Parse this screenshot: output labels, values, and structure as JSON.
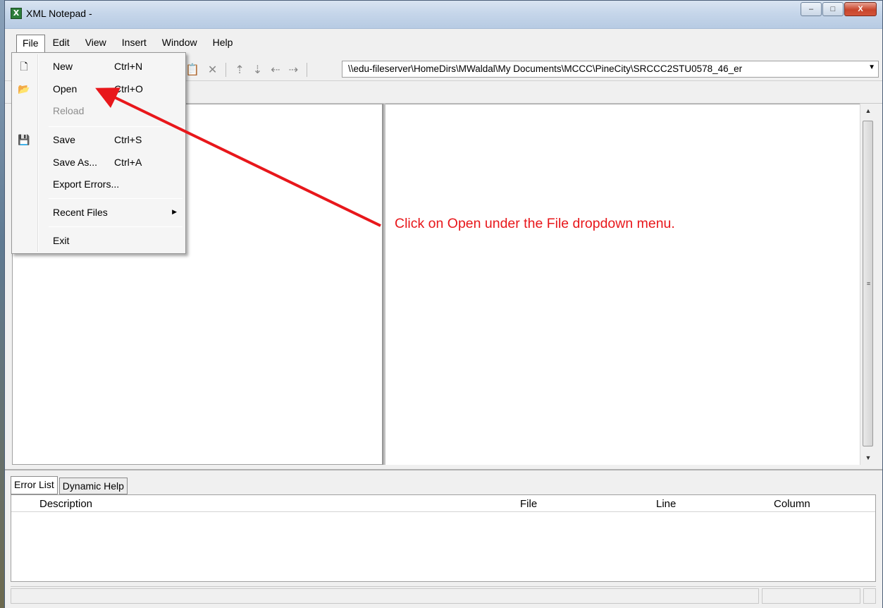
{
  "window": {
    "title": "XML Notepad -",
    "app_icon_letter": "X",
    "controls": {
      "minimize": "–",
      "maximize": "□",
      "close": "X"
    }
  },
  "menubar": {
    "items": [
      "File",
      "Edit",
      "View",
      "Insert",
      "Window",
      "Help"
    ],
    "active": "File"
  },
  "toolbar": {
    "path": "\\\\edu-fileserver\\HomeDirs\\MWaldal\\My Documents\\MCCC\\PineCity\\SRCCC2STU0578_46_er"
  },
  "file_menu": {
    "items": [
      {
        "label": "New",
        "shortcut": "Ctrl+N",
        "icon": "new-document-icon",
        "enabled": true
      },
      {
        "label": "Open",
        "shortcut": "Ctrl+O",
        "icon": "open-folder-icon",
        "enabled": true
      },
      {
        "label": "Reload",
        "shortcut": "",
        "icon": "",
        "enabled": false
      },
      {
        "label": "Save",
        "shortcut": "Ctrl+S",
        "icon": "floppy-disk-icon",
        "enabled": true
      },
      {
        "label": "Save As...",
        "shortcut": "Ctrl+A",
        "icon": "",
        "enabled": true
      },
      {
        "label": "Export Errors...",
        "shortcut": "",
        "icon": "",
        "enabled": true
      },
      {
        "label": "Recent Files",
        "shortcut": "",
        "icon": "",
        "enabled": true,
        "has_submenu": true
      },
      {
        "label": "Exit",
        "shortcut": "",
        "icon": "",
        "enabled": true
      }
    ]
  },
  "annotation": {
    "text": "Click on Open under the File dropdown menu.",
    "color": "#e8171b"
  },
  "bottom_panel": {
    "tabs": [
      "Error List",
      "Dynamic Help"
    ],
    "active_tab": "Error List",
    "columns": [
      "Description",
      "File",
      "Line",
      "Column"
    ]
  }
}
